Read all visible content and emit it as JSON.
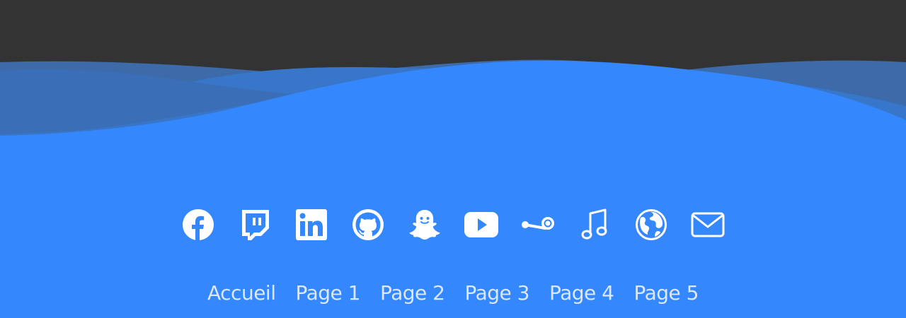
{
  "colors": {
    "header_bg": "#333333",
    "footer_blue": "#3587fe",
    "wave_back": "#3e6eae",
    "wave_mid": "#3a7ad0",
    "icon_color": "#ffffff",
    "nav_text": "#dbe7fb"
  },
  "footer": {
    "social_icons": [
      {
        "icon": "facebook-icon"
      },
      {
        "icon": "twitch-icon"
      },
      {
        "icon": "linkedin-icon"
      },
      {
        "icon": "github-icon"
      },
      {
        "icon": "snapchat-icon"
      },
      {
        "icon": "youtube-icon"
      },
      {
        "icon": "steam-icon"
      },
      {
        "icon": "music-note-icon"
      },
      {
        "icon": "globe-icon"
      },
      {
        "icon": "mail-icon"
      }
    ],
    "nav_links": [
      "Accueil",
      "Page 1",
      "Page 2",
      "Page 3",
      "Page 4",
      "Page 5"
    ]
  }
}
